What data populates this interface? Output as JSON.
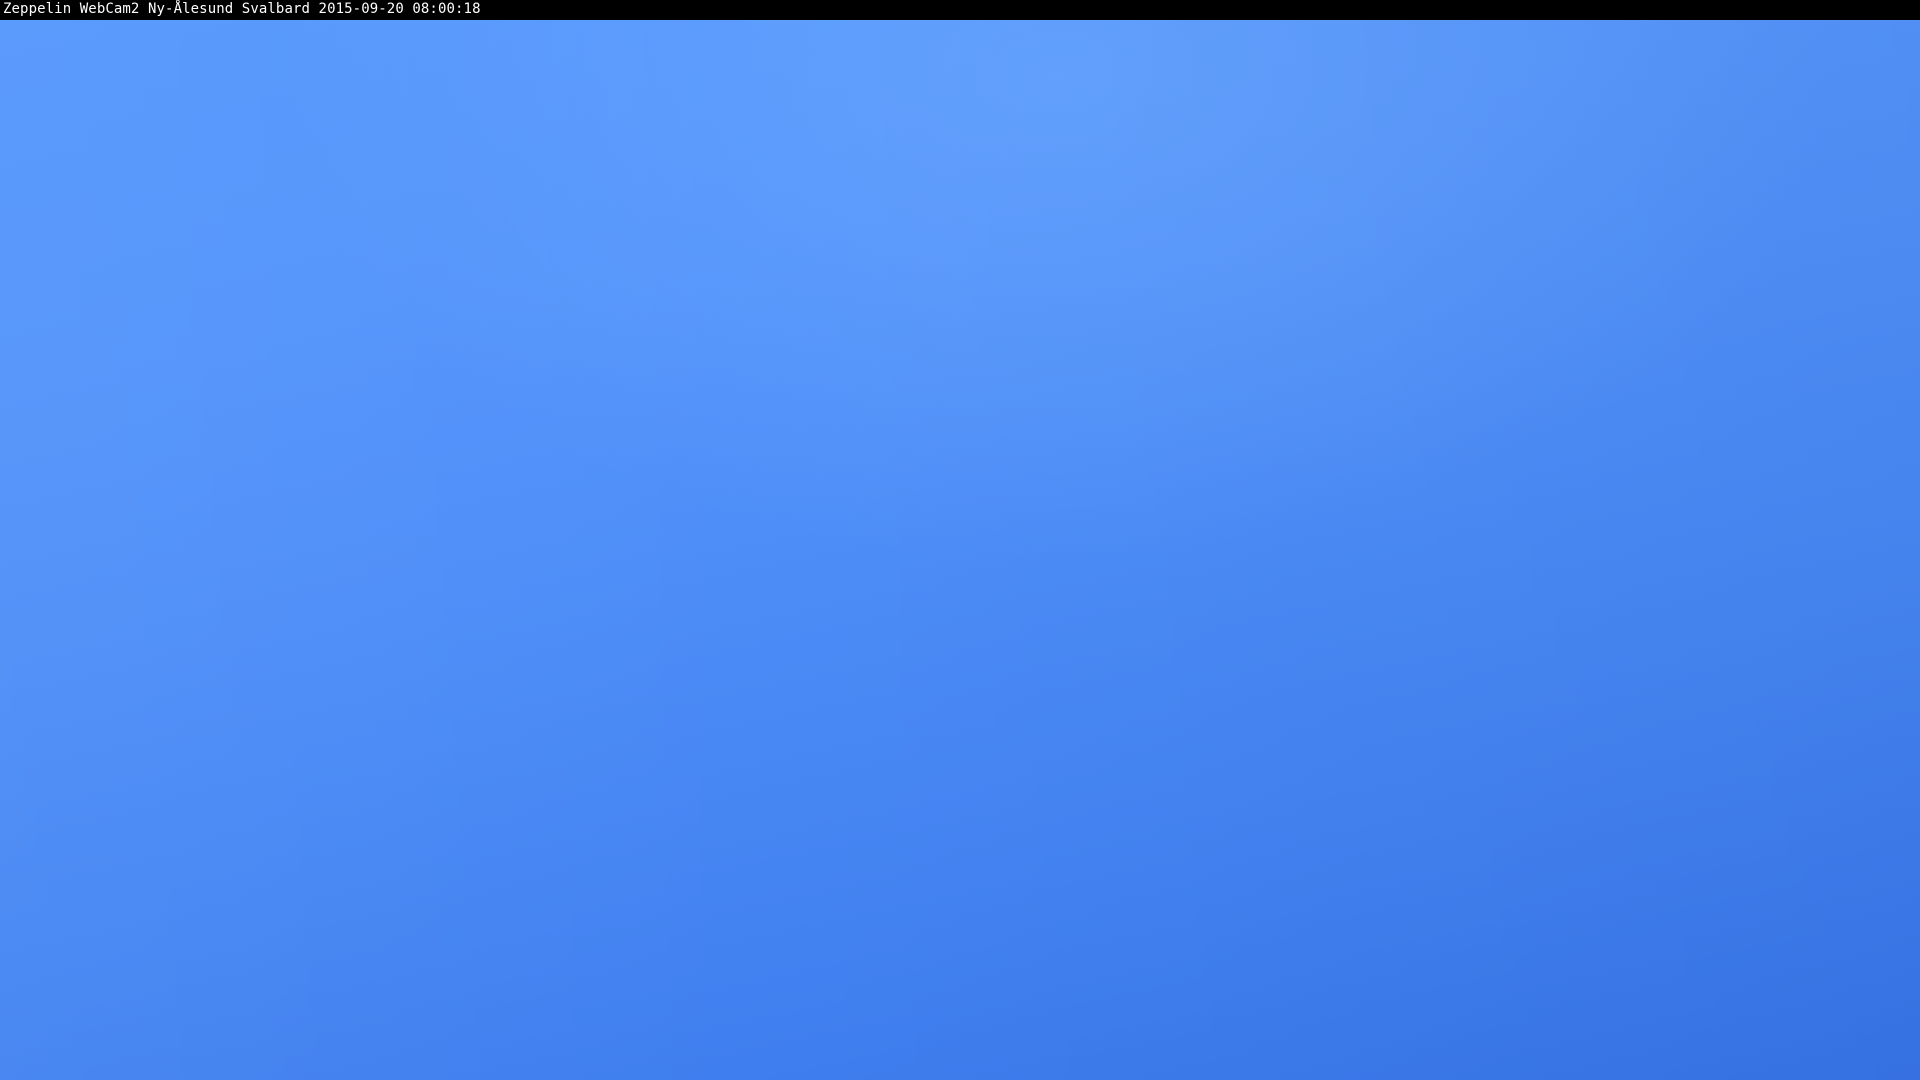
{
  "caption": {
    "text": "Zeppelin WebCam2 Ny-Ålesund Svalbard 2015-09-20 08:00:18"
  },
  "colors": {
    "caption_background": "#000000",
    "caption_text": "#ffffff",
    "sky_top": "#5698fc",
    "sky_bottom": "#3774e6"
  }
}
